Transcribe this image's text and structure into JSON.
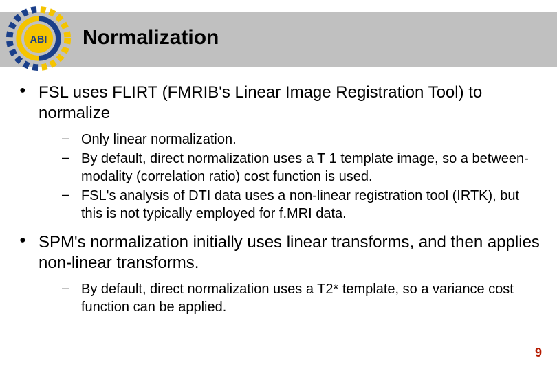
{
  "logo": {
    "label": "ABI"
  },
  "title": "Normalization",
  "bullets": [
    {
      "text": "FSL uses FLIRT (FMRIB's Linear Image Registration Tool) to normalize",
      "sub": [
        "Only linear normalization.",
        "By default, direct normalization uses a T 1 template image, so a between-modality (correlation ratio) cost function is used.",
        "FSL's analysis of DTI data uses a non-linear registration tool (IRTK), but this is not typically employed for f.MRI data."
      ]
    },
    {
      "text": "SPM's normalization initially uses linear transforms, and then applies non-linear transforms.",
      "sub": [
        "By default, direct normalization uses a T2* template, so a variance cost function can be applied."
      ]
    }
  ],
  "page_number": "9"
}
